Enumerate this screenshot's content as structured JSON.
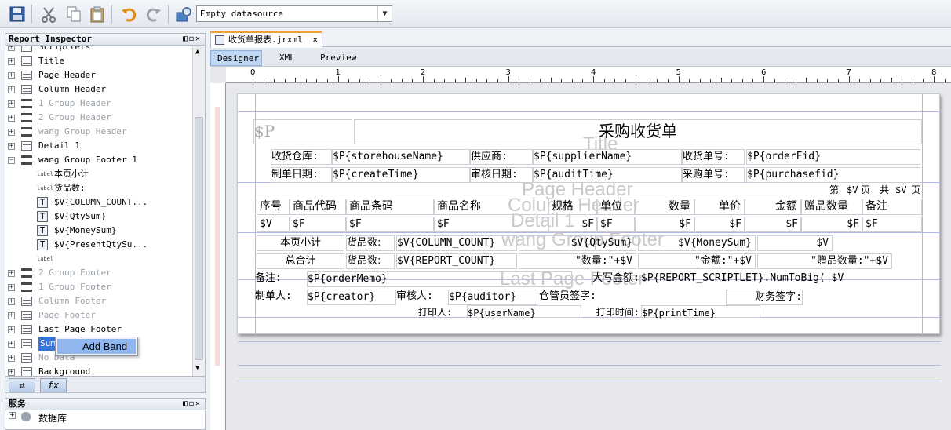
{
  "toolbar": {
    "icons": [
      "save-icon",
      "cut-icon",
      "copy-icon",
      "paste-icon",
      "undo-icon",
      "redo-icon",
      "run-report-icon"
    ],
    "datasource": "Empty datasource"
  },
  "inspector": {
    "title": "Report Inspector",
    "items": [
      {
        "label": "Scriptlets",
        "kind": "band",
        "gray": false
      },
      {
        "label": "Title",
        "kind": "band",
        "gray": false
      },
      {
        "label": "Page Header",
        "kind": "band",
        "gray": false
      },
      {
        "label": "Column Header",
        "kind": "band",
        "gray": false
      },
      {
        "label": "1 Group Header",
        "kind": "group",
        "gray": true
      },
      {
        "label": "2 Group Header",
        "kind": "group",
        "gray": true
      },
      {
        "label": "wang Group Header",
        "kind": "group",
        "gray": true
      },
      {
        "label": "Detail 1",
        "kind": "band",
        "gray": false
      },
      {
        "label": "wang Group Footer 1",
        "kind": "group",
        "gray": false
      },
      {
        "label": "本页小计",
        "kind": "label",
        "gray": false
      },
      {
        "label": "货品数:",
        "kind": "label",
        "gray": false
      },
      {
        "label": "$V{COLUMN_COUNT...",
        "kind": "field",
        "gray": false
      },
      {
        "label": "$V{QtySum}",
        "kind": "field",
        "gray": false
      },
      {
        "label": "$V{MoneySum}",
        "kind": "field",
        "gray": false
      },
      {
        "label": "$V{PresentQtySu...",
        "kind": "field",
        "gray": false
      },
      {
        "label": "",
        "kind": "label",
        "gray": false
      },
      {
        "label": "2 Group Footer",
        "kind": "group",
        "gray": true
      },
      {
        "label": "1 Group Footer",
        "kind": "group",
        "gray": true
      },
      {
        "label": "Column Footer",
        "kind": "band",
        "gray": true
      },
      {
        "label": "Page Footer",
        "kind": "band",
        "gray": true
      },
      {
        "label": "Last Page Footer",
        "kind": "band",
        "gray": false
      },
      {
        "label": "Summ",
        "kind": "band",
        "gray": false
      },
      {
        "label": "No Data",
        "kind": "band",
        "gray": true
      },
      {
        "label": "Background",
        "kind": "band",
        "gray": false
      }
    ],
    "context_menu": "Add Band"
  },
  "services": {
    "title": "服务",
    "item": "数据库"
  },
  "editor": {
    "tab": "收货单报表.jrxml",
    "subtabs": [
      "Designer",
      "XML",
      "Preview"
    ],
    "ruler_marks": [
      "0",
      "1",
      "2",
      "3",
      "4",
      "5",
      "6",
      "7",
      "8"
    ]
  },
  "report": {
    "watermarks": [
      "Title",
      "Page Header",
      "Column Header",
      "Detail 1",
      "wang Group Footer",
      "Last Page Footer"
    ],
    "title": "采购收货单",
    "logo": "$P",
    "r1": [
      "收货仓库:",
      "$P{storehouseName}",
      "供应商:",
      "$P{supplierName}",
      "收货单号:",
      "$P{orderFid}"
    ],
    "r2": [
      "制单日期:",
      "$P{createTime}",
      "审核日期:",
      "$P{auditTime}",
      "采购单号:",
      "$P{purchasefid}"
    ],
    "page": [
      "第",
      "$V",
      "页",
      "共",
      "$V",
      "页"
    ],
    "headers": [
      "序号",
      "商品代码",
      "商品条码",
      "商品名称",
      "规格",
      "单位",
      "数量",
      "单价",
      "金额",
      "赠品数量",
      "备注"
    ],
    "detail": [
      "$V",
      "$F",
      "$F",
      "$F",
      "$F",
      "$F",
      "$F",
      "$F",
      "$F",
      "$F",
      "$F"
    ],
    "subtotal": [
      "本页小计",
      "货品数:",
      "$V{COLUMN_COUNT}",
      "$V{QtySum}",
      "$V{MoneySum}",
      "$V"
    ],
    "total": [
      "总合计",
      "货品数:",
      "$V{REPORT_COUNT}",
      "\"数量:\"+$V",
      "\"金额:\"+$V",
      "\"赠品数量:\"+$V"
    ],
    "footer1": [
      "备注:",
      "$P{orderMemo}",
      "大写金额:",
      "$P{REPORT_SCRIPTLET}.NumToBig( $V"
    ],
    "footer2": [
      "制单人:",
      "$P{creator}",
      "审核人:",
      "$P{auditor}",
      "仓管员签字:",
      "财务签字:"
    ],
    "footer3": [
      "打印人:",
      "$P{userName}",
      "打印时间:",
      "$P{printTime}"
    ]
  }
}
